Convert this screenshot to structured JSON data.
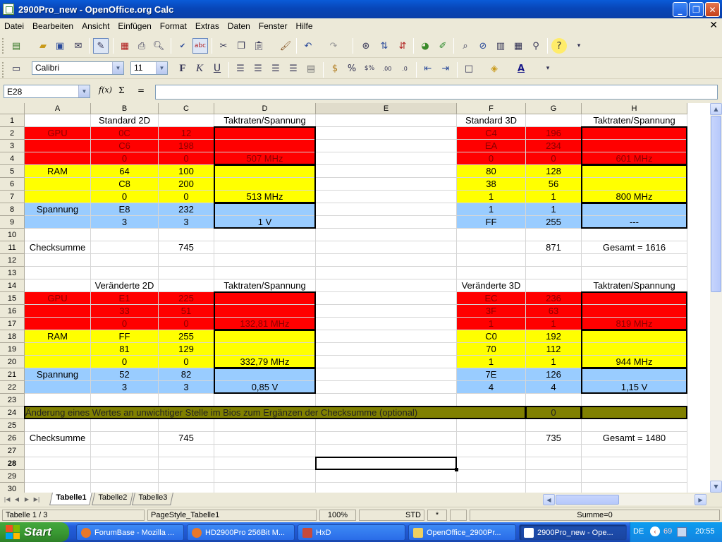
{
  "window": {
    "title": "2900Pro_new - OpenOffice.org Calc",
    "controls": {
      "minimize": "_",
      "maximize": "❐",
      "close": "✕"
    }
  },
  "menu": [
    "Datei",
    "Bearbeiten",
    "Ansicht",
    "Einfügen",
    "Format",
    "Extras",
    "Daten",
    "Fenster",
    "Hilfe"
  ],
  "format_toolbar": {
    "font_name": "Calibri",
    "font_size": "11",
    "bold": "F",
    "italic": "K",
    "underline": "U"
  },
  "formula_bar": {
    "name_box": "E28",
    "fx": "f(x)",
    "sum": "Σ",
    "equals": "=",
    "content": ""
  },
  "columns": [
    "A",
    "B",
    "C",
    "D",
    "E",
    "F",
    "G",
    "H"
  ],
  "rows": [
    "1",
    "2",
    "3",
    "4",
    "5",
    "6",
    "7",
    "8",
    "9",
    "10",
    "11",
    "12",
    "13",
    "14",
    "15",
    "16",
    "17",
    "18",
    "19",
    "20",
    "21",
    "22",
    "23",
    "24",
    "25",
    "26",
    "27",
    "28",
    "29",
    "30"
  ],
  "cells": {
    "B1": "Standard 2D",
    "D1": "Taktraten/Spannung",
    "F1": "Standard 3D",
    "H1": "Taktraten/Spannung",
    "A2": "GPU",
    "B2": "0C",
    "C2": "12",
    "F2": "C4",
    "G2": "196",
    "B3": "C6",
    "C3": "198",
    "F3": "EA",
    "G3": "234",
    "B4": "0",
    "C4": "0",
    "D4": "507 MHz",
    "F4": "0",
    "G4": "0",
    "H4": "601 MHz",
    "A5": "RAM",
    "B5": "64",
    "C5": "100",
    "F5": "80",
    "G5": "128",
    "B6": "C8",
    "C6": "200",
    "F6": "38",
    "G6": "56",
    "B7": "0",
    "C7": "0",
    "D7": "513 MHz",
    "F7": "1",
    "G7": "1",
    "H7": "800 MHz",
    "A8": "Spannung",
    "B8": "E8",
    "C8": "232",
    "F8": "1",
    "G8": "1",
    "B9": "3",
    "C9": "3",
    "D9": "1 V",
    "F9": "FF",
    "G9": "255",
    "H9": "---",
    "A11": "Checksumme",
    "C11": "745",
    "G11": "871",
    "H11": "Gesamt = 1616",
    "B14": "Veränderte 2D",
    "D14": "Taktraten/Spannung",
    "F14": "Veränderte 3D",
    "H14": "Taktraten/Spannung",
    "A15": "GPU",
    "B15": "E1",
    "C15": "225",
    "F15": "EC",
    "G15": "236",
    "B16": "33",
    "C16": "51",
    "F16": "3F",
    "G16": "63",
    "B17": "0",
    "C17": "0",
    "D17": "132,81 MHz",
    "F17": "1",
    "G17": "1",
    "H17": "819 MHz",
    "A18": "RAM",
    "B18": "FF",
    "C18": "255",
    "F18": "C0",
    "G18": "192",
    "B19": "81",
    "C19": "129",
    "F19": "70",
    "G19": "112",
    "B20": "0",
    "C20": "0",
    "D20": "332,79 MHz",
    "F20": "1",
    "G20": "1",
    "H20": "944 MHz",
    "A21": "Spannung",
    "B21": "52",
    "C21": "82",
    "F21": "7E",
    "G21": "126",
    "B22": "3",
    "C22": "3",
    "D22": "0,85 V",
    "F22": "4",
    "G22": "4",
    "H22": "1,15 V",
    "A24": "Änderung eines Wertes an unwichtiger Stelle im Bios zum Ergänzen der Checksumme (optional)",
    "G24": "0",
    "A26": "Checksumme",
    "C26": "745",
    "G26": "735",
    "H26": "Gesamt = 1480"
  },
  "sheet_tabs": [
    "Tabelle1",
    "Tabelle2",
    "Tabelle3"
  ],
  "active_tab": "Tabelle1",
  "status": {
    "sheet": "Tabelle 1 / 3",
    "page_style": "PageStyle_Tabelle1",
    "zoom": "100%",
    "mode": "STD",
    "modified": "*",
    "sum": "Summe=0"
  },
  "taskbar": {
    "start": "Start",
    "tasks": [
      "ForumBase - Mozilla ...",
      "HD2900Pro 256Bit M...",
      "HxD",
      "OpenOffice_2900Pr...",
      "2900Pro_new - Ope..."
    ],
    "active_task": 4,
    "lang": "DE",
    "tray_count": "69",
    "clock": "20:55"
  },
  "colors": {
    "red": "#ff0000",
    "yellow": "#ffff00",
    "blue": "#99ccff",
    "olive": "#808000"
  }
}
